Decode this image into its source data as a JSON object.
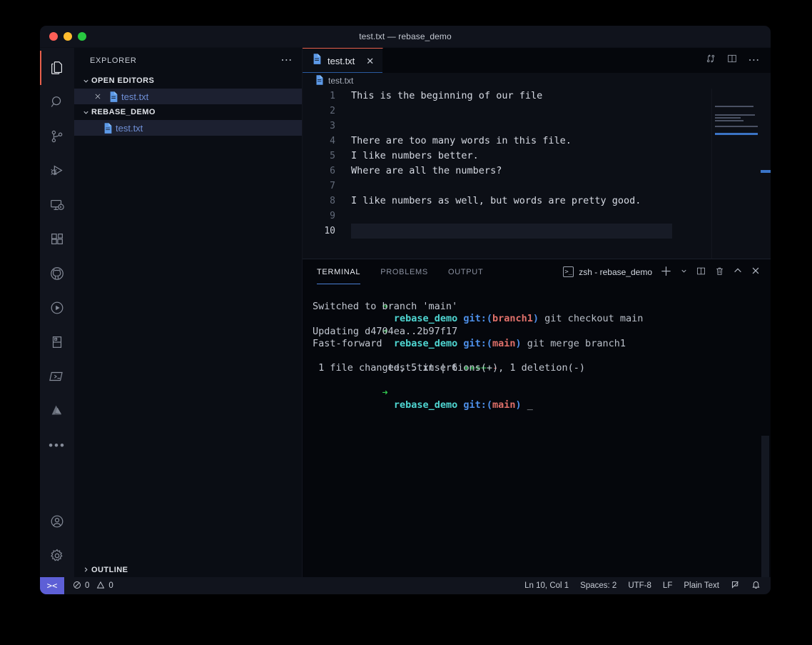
{
  "window": {
    "title": "test.txt — rebase_demo"
  },
  "activitybar": {
    "items": [
      {
        "name": "explorer",
        "icon": "files-icon",
        "active": true
      },
      {
        "name": "search",
        "icon": "search-icon",
        "active": false
      },
      {
        "name": "source-control",
        "icon": "source-control-icon",
        "active": false
      },
      {
        "name": "run-and-debug",
        "icon": "debug-icon",
        "active": false
      },
      {
        "name": "remote-explorer",
        "icon": "remote-monitor-icon",
        "active": false
      },
      {
        "name": "extensions",
        "icon": "extensions-icon",
        "active": false
      },
      {
        "name": "github",
        "icon": "github-icon",
        "active": false
      },
      {
        "name": "run",
        "icon": "play-circle-icon",
        "active": false
      },
      {
        "name": "notebook",
        "icon": "notebook-icon",
        "active": false
      },
      {
        "name": "terminal-ext",
        "icon": "terminal-icon",
        "active": false
      },
      {
        "name": "azure",
        "icon": "azure-icon",
        "active": false
      }
    ],
    "more_label": "•••",
    "bottom": [
      {
        "name": "accounts",
        "icon": "account-icon"
      },
      {
        "name": "settings",
        "icon": "gear-icon"
      }
    ]
  },
  "sidebar": {
    "header": "EXPLORER",
    "header_more": "⋯",
    "sections": [
      {
        "title": "OPEN EDITORS",
        "expanded": true,
        "items": [
          {
            "label": "test.txt",
            "selected": true,
            "closable": true
          }
        ]
      },
      {
        "title": "REBASE_DEMO",
        "expanded": true,
        "items": [
          {
            "label": "test.txt",
            "selected": true,
            "closable": false
          }
        ]
      }
    ],
    "outline": {
      "title": "OUTLINE",
      "expanded": false
    }
  },
  "editor": {
    "tabs": [
      {
        "label": "test.txt",
        "active": true,
        "close": "✕"
      }
    ],
    "tab_actions": [
      {
        "name": "split-compare-icon"
      },
      {
        "name": "split-editor-icon"
      },
      {
        "name": "more-actions-icon",
        "glyph": "⋯"
      }
    ],
    "breadcrumb": "test.txt",
    "lines": [
      {
        "number": "1",
        "text": "This is the beginning of our file"
      },
      {
        "number": "2",
        "text": ""
      },
      {
        "number": "3",
        "text": ""
      },
      {
        "number": "4",
        "text": "There are too many words in this file."
      },
      {
        "number": "5",
        "text": "I like numbers better."
      },
      {
        "number": "6",
        "text": "Where are all the numbers?"
      },
      {
        "number": "7",
        "text": ""
      },
      {
        "number": "8",
        "text": "I like numbers as well, but words are pretty good."
      },
      {
        "number": "9",
        "text": ""
      },
      {
        "number": "10",
        "text": "",
        "current": true
      }
    ]
  },
  "panel": {
    "tabs": [
      {
        "label": "TERMINAL",
        "active": true
      },
      {
        "label": "PROBLEMS",
        "active": false
      },
      {
        "label": "OUTPUT",
        "active": false
      }
    ],
    "terminal_selector": "zsh - rebase_demo",
    "actions": [
      {
        "name": "new-terminal-icon",
        "glyph": "＋"
      },
      {
        "name": "terminal-dropdown-icon",
        "glyph": "⌄"
      },
      {
        "name": "split-terminal-icon",
        "glyph": "▯"
      },
      {
        "name": "kill-terminal-icon",
        "glyph": "🗑"
      },
      {
        "name": "maximize-panel-icon",
        "glyph": "⌃"
      },
      {
        "name": "close-panel-icon",
        "glyph": "✕"
      }
    ],
    "terminal_lines": [
      {
        "type": "prompt",
        "arrow": "➜",
        "dir": "rebase_demo",
        "git_prefix": "git:(",
        "branch": "branch1",
        "git_suffix": ")",
        "command": " git checkout main"
      },
      {
        "type": "plain",
        "text": "Switched to branch 'main'"
      },
      {
        "type": "prompt",
        "arrow": "➜",
        "dir": "rebase_demo",
        "git_prefix": "git:(",
        "branch": "main",
        "git_suffix": ")",
        "command": " git merge branch1"
      },
      {
        "type": "plain",
        "text": "Updating d4704ea..2b97f17"
      },
      {
        "type": "plain",
        "text": "Fast-forward"
      },
      {
        "type": "diffstat",
        "file": " test.txt | 6 ",
        "plus": "+++++",
        "minus": "-"
      },
      {
        "type": "plain",
        "text": " 1 file changed, 5 insertions(+), 1 deletion(-)"
      },
      {
        "type": "prompt",
        "arrow": "➜",
        "dir": "rebase_demo",
        "git_prefix": "git:(",
        "branch": "main",
        "git_suffix": ")",
        "command": " _"
      }
    ]
  },
  "statusbar": {
    "remote_glyph": "><",
    "errors": "0",
    "warnings": "0",
    "cursor_position": "Ln 10, Col 1",
    "indentation": "Spaces: 2",
    "encoding": "UTF-8",
    "eol": "LF",
    "language": "Plain Text",
    "feedback_icon": "feedback-icon",
    "bell_icon": "bell-icon"
  },
  "colors": {
    "accent_tab_border": "#e8604c",
    "remote_badge": "#5d5fd6",
    "link_blue": "#6f8fd6",
    "terminal_green": "#30c94f",
    "terminal_cyan": "#4fd6d2",
    "terminal_blue": "#4d8fe8",
    "terminal_red": "#e0706a"
  }
}
